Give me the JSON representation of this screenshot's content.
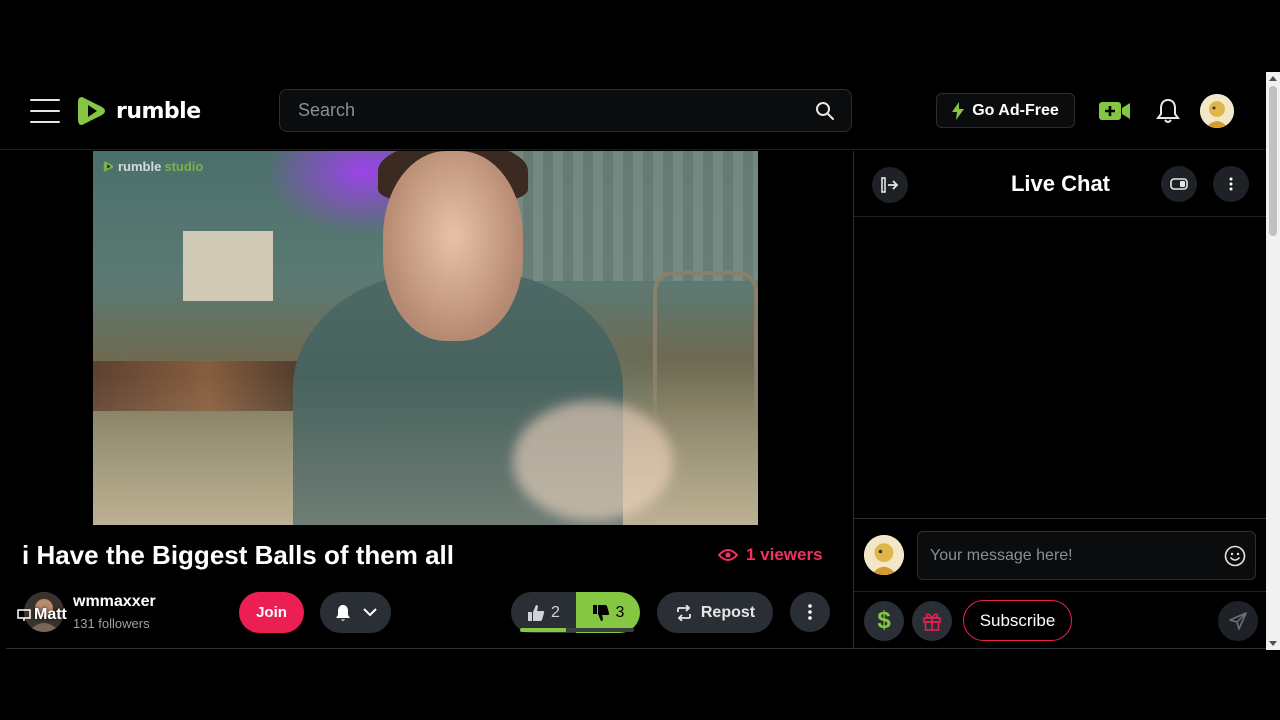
{
  "header": {
    "logo_text": "rumble",
    "search_placeholder": "Search",
    "ad_free_label": "Go Ad-Free",
    "icons": [
      "menu-icon",
      "search-icon",
      "lightning-icon",
      "go-live-icon",
      "bell-icon"
    ]
  },
  "video": {
    "watermark_brand": "rumble",
    "watermark_suffix": "studio"
  },
  "stream": {
    "title": "i Have the Biggest Balls of them all",
    "viewers": "1 viewers"
  },
  "channel": {
    "avatar_label": "Matt",
    "name": "wmmaxxer",
    "followers": "131 followers",
    "join_label": "Join"
  },
  "actions": {
    "upvotes": "2",
    "downvotes": "3",
    "upvote_fraction": 0.4,
    "repost_label": "Repost"
  },
  "chat": {
    "title": "Live Chat",
    "input_placeholder": "Your message here!",
    "rant_symbol": "$",
    "subscribe_label": "Subscribe"
  },
  "colors": {
    "brand_green": "#85c742",
    "accent_red": "#ec1f53",
    "viewer_red": "#f23160",
    "button_bg": "#2a2f36"
  }
}
